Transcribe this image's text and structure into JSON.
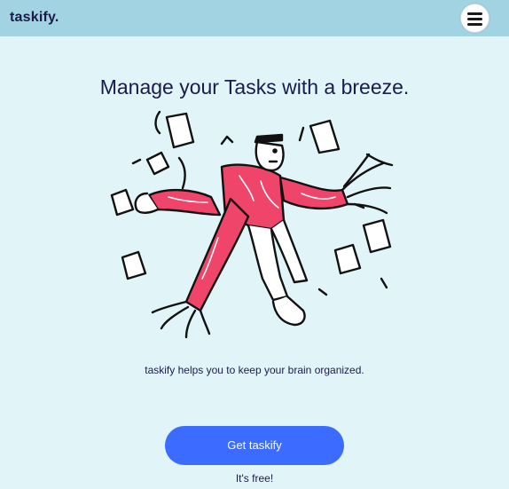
{
  "navbar": {
    "brand": "taskify.",
    "menu_icon": "hamburger-menu-icon"
  },
  "hero": {
    "headline": "Manage your Tasks with a breeze.",
    "illustration": "juggling-papers-person-illustration",
    "tagline": "taskify helps you to keep your brain organized.",
    "cta_label": "Get taskify",
    "cta_note": "It's free!"
  },
  "colors": {
    "page_bg": "#e1f4f8",
    "navbar_bg": "#a2d3e2",
    "text": "#1b1b4b",
    "cta_bg": "#3c6cff",
    "shirt": "#f0456a"
  }
}
